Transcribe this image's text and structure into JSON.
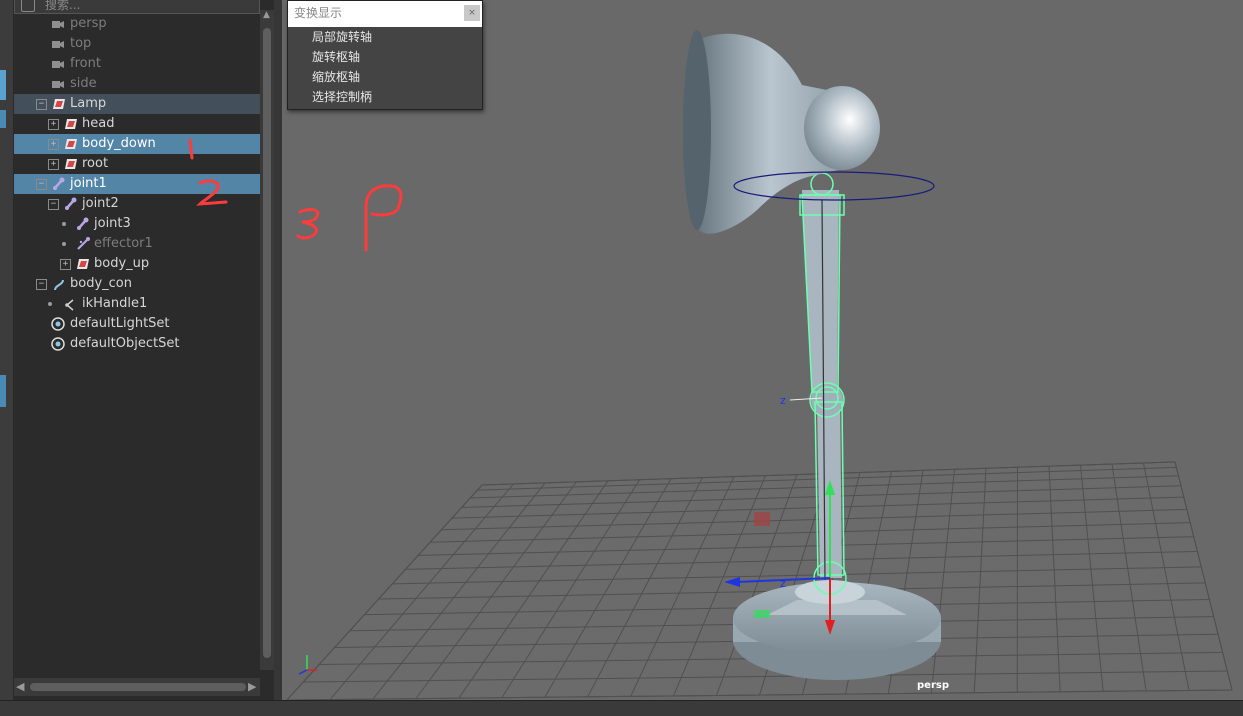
{
  "outliner": {
    "search_placeholder": "搜索...",
    "items": [
      {
        "label": "persp",
        "icon": "camera-icon",
        "state": "dim"
      },
      {
        "label": "top",
        "icon": "camera-icon",
        "state": "dim"
      },
      {
        "label": "front",
        "icon": "camera-icon",
        "state": "dim"
      },
      {
        "label": "side",
        "icon": "camera-icon",
        "state": "dim"
      },
      {
        "label": "Lamp",
        "icon": "transform-icon",
        "state": "highlight"
      },
      {
        "label": "head",
        "icon": "transform-icon",
        "state": "normal"
      },
      {
        "label": "body_down",
        "icon": "transform-icon",
        "state": "selected"
      },
      {
        "label": "root",
        "icon": "transform-icon",
        "state": "normal"
      },
      {
        "label": "joint1",
        "icon": "joint-icon",
        "state": "selected"
      },
      {
        "label": "joint2",
        "icon": "joint-icon",
        "state": "normal"
      },
      {
        "label": "joint3",
        "icon": "joint-icon",
        "state": "normal"
      },
      {
        "label": "effector1",
        "icon": "effector-icon",
        "state": "dim"
      },
      {
        "label": "body_up",
        "icon": "transform-icon",
        "state": "normal"
      },
      {
        "label": "body_con",
        "icon": "curve-icon",
        "state": "normal"
      },
      {
        "label": "ikHandle1",
        "icon": "ik-handle-icon",
        "state": "normal"
      },
      {
        "label": "defaultLightSet",
        "icon": "set-icon",
        "state": "normal"
      },
      {
        "label": "defaultObjectSet",
        "icon": "set-icon",
        "state": "normal"
      }
    ]
  },
  "menu": {
    "title": "变换显示",
    "close": "×",
    "items": [
      "局部旋转轴",
      "旋转枢轴",
      "缩放枢轴",
      "选择控制柄"
    ]
  },
  "viewport": {
    "camera_label": "persp",
    "axis_z_label": "z",
    "annotations": [
      "1",
      "2",
      "3 P"
    ]
  },
  "colors": {
    "selected_row": "#5285a6",
    "highlight_row": "#43505b",
    "viewport_bg": "#696969",
    "annotation": "#ff3b3b",
    "wireframe": "#6dffb0"
  }
}
